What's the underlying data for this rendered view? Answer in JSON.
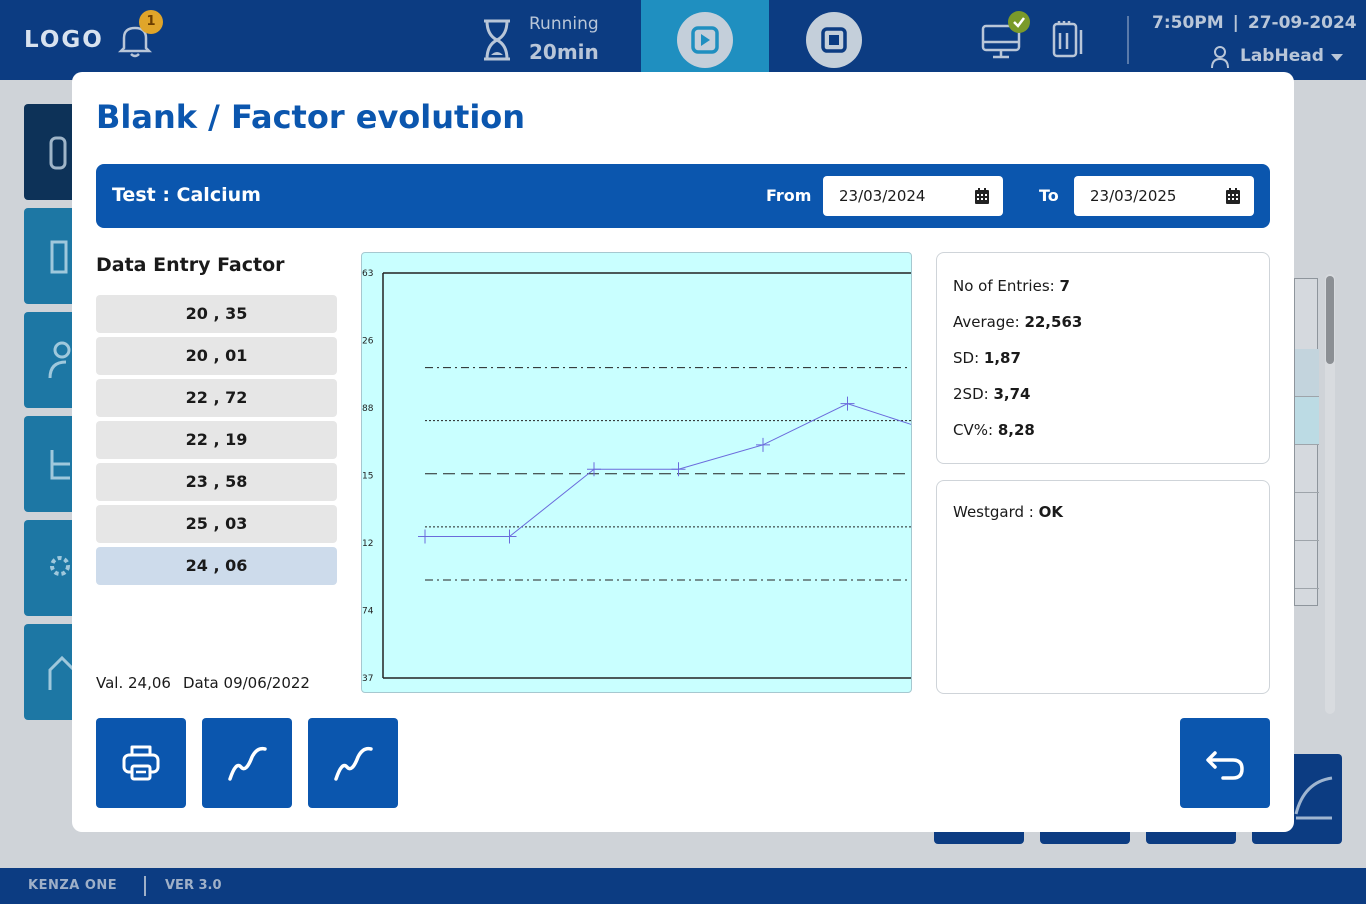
{
  "header": {
    "logo": "LOGO",
    "notification_count": "1",
    "run_status": "Running",
    "run_time": "20min",
    "time": "7:50PM",
    "separator": "|",
    "date": "27-09-2024",
    "user": "LabHead"
  },
  "footer": {
    "brand": "KENZA ONE",
    "version": "VER 3.0"
  },
  "modal": {
    "title": "Blank / Factor evolution",
    "test_label": "Test : Calcium",
    "from_label": "From",
    "from_date": "23/03/2024",
    "to_label": "To",
    "to_date": "23/03/2025",
    "entries_title": "Data Entry Factor",
    "entries": [
      "20 , 35",
      "20 , 01",
      "22 , 72",
      "22 , 19",
      "23 , 58",
      "25 , 03",
      "24 , 06"
    ],
    "selected_entry_index": 6,
    "selected_value": "Val. 24,06",
    "selected_data": "Data 09/06/2022",
    "stats": {
      "entries_label": "No of Entries:",
      "entries_value": "7",
      "average_label": "Average:",
      "average_value": "22,563",
      "sd_label": "SD:",
      "sd_value": "1,87",
      "sd2_label": "2SD:",
      "sd2_value": "3,74",
      "cv_label": "CV%:",
      "cv_value": "8,28"
    },
    "westgard_label": "Westgard :",
    "westgard_value": "OK"
  },
  "icons": [
    "bell-icon",
    "hourglass-icon",
    "play-icon",
    "stop-icon",
    "monitor-icon",
    "clipboard-icon",
    "user-icon",
    "calendar-icon",
    "printer-icon",
    "chart-line-icon",
    "back-arrow-icon"
  ],
  "colors": {
    "primary": "#0b56ae",
    "header": "#0c3c82",
    "chart_bg": "#c9ffff",
    "series": "#6b6bdc"
  },
  "chart_data": {
    "type": "line",
    "y_tick_labels": [
      "63",
      "26",
      "88",
      "15",
      "12",
      "74",
      "37"
    ],
    "y_range": [
      15.37,
      29.63
    ],
    "points": [
      20.35,
      20.35,
      22.72,
      22.72,
      23.58,
      25.03,
      24.06
    ],
    "x_index": [
      1,
      2,
      3,
      4,
      5,
      6,
      7
    ],
    "mean": 22.56,
    "sd1": [
      20.69,
      24.43
    ],
    "sd2": [
      18.82,
      26.3
    ],
    "reference_lines": {
      "mean": "dashed",
      "sd1": "dotted",
      "sd2": "dash-dot"
    },
    "grid": false
  }
}
